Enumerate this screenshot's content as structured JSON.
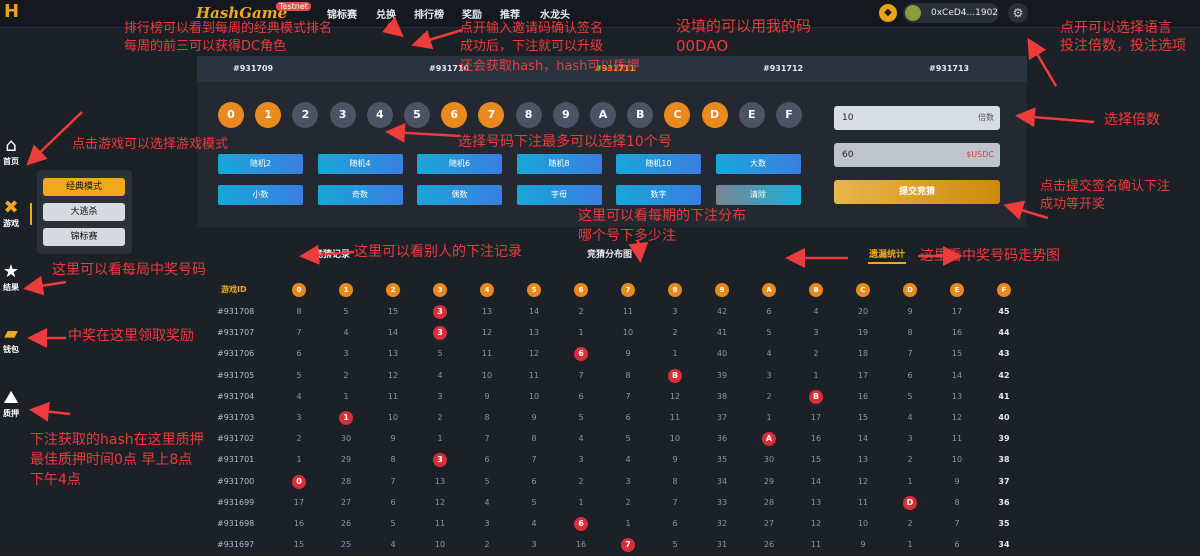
{
  "topbar": {
    "logo": "H",
    "brand": "HashGame",
    "brand_tag": "Testnet",
    "nav": [
      "锦标赛",
      "兑换",
      "排行榜",
      "奖励",
      "推荐",
      "水龙头"
    ],
    "wallet_icon": "wallet-icon",
    "address": "0xCeD4...1902",
    "gear_icon": "gear-icon"
  },
  "sidebar": {
    "items": [
      {
        "label": "首页",
        "icon": "home-icon",
        "glyph": "⌂"
      },
      {
        "label": "游戏",
        "icon": "game-icon",
        "glyph": "✖"
      },
      {
        "label": "结果",
        "icon": "star-icon",
        "glyph": "★"
      },
      {
        "label": "钱包",
        "icon": "wallet-icon",
        "glyph": "▰"
      },
      {
        "label": "质押",
        "icon": "stake-icon",
        "glyph": "⛰"
      }
    ],
    "submenu": [
      "经典模式",
      "大逃杀",
      "锦标赛"
    ]
  },
  "game": {
    "rounds": [
      "#931709",
      "#931710",
      "#931711",
      "#931712",
      "#931713"
    ],
    "balls": [
      {
        "label": "0",
        "state": "hot"
      },
      {
        "label": "1",
        "state": "hot"
      },
      {
        "label": "2",
        "state": "cold"
      },
      {
        "label": "3",
        "state": "cold"
      },
      {
        "label": "4",
        "state": "cold"
      },
      {
        "label": "5",
        "state": "cold"
      },
      {
        "label": "6",
        "state": "hot"
      },
      {
        "label": "7",
        "state": "hot"
      },
      {
        "label": "8",
        "state": "cold"
      },
      {
        "label": "9",
        "state": "cold"
      },
      {
        "label": "A",
        "state": "cold"
      },
      {
        "label": "B",
        "state": "cold"
      },
      {
        "label": "C",
        "state": "hot"
      },
      {
        "label": "D",
        "state": "hot"
      },
      {
        "label": "E",
        "state": "cold"
      },
      {
        "label": "F",
        "state": "cold"
      }
    ],
    "random_buttons_row1": [
      "随机2",
      "随机4",
      "随机6",
      "随机8",
      "随机10",
      "大数"
    ],
    "random_buttons_row2": [
      "小数",
      "奇数",
      "偶数",
      "字母",
      "数字",
      "清除"
    ],
    "multiplier_value": "10",
    "multiplier_suffix": "倍数",
    "amount_value": "60",
    "amount_suffix": "$USDC",
    "submit_label": "提交竞猜"
  },
  "stats": {
    "tabs": [
      "竞猜记录",
      "竞猜分布图",
      "遗漏统计"
    ],
    "active_tab": "遗漏统计",
    "id_header": "游戏ID",
    "columns": [
      "0",
      "1",
      "2",
      "3",
      "4",
      "5",
      "6",
      "7",
      "8",
      "9",
      "A",
      "B",
      "C",
      "D",
      "E",
      "F"
    ],
    "rows": [
      {
        "id": "#931708",
        "cells": [
          "8",
          "5",
          "15",
          "3",
          "13",
          "14",
          "2",
          "11",
          "3",
          "42",
          "6",
          "4",
          "20",
          "9",
          "17",
          "45"
        ],
        "hit": 3
      },
      {
        "id": "#931707",
        "cells": [
          "7",
          "4",
          "14",
          "3",
          "12",
          "13",
          "1",
          "10",
          "2",
          "41",
          "5",
          "3",
          "19",
          "8",
          "16",
          "44"
        ],
        "hit": 3
      },
      {
        "id": "#931706",
        "cells": [
          "6",
          "3",
          "13",
          "5",
          "11",
          "12",
          "6",
          "9",
          "1",
          "40",
          "4",
          "2",
          "18",
          "7",
          "15",
          "43"
        ],
        "hit": 6
      },
      {
        "id": "#931705",
        "cells": [
          "5",
          "2",
          "12",
          "4",
          "10",
          "11",
          "7",
          "8",
          "B",
          "39",
          "3",
          "1",
          "17",
          "6",
          "14",
          "42"
        ],
        "hit": 8
      },
      {
        "id": "#931704",
        "cells": [
          "4",
          "1",
          "11",
          "3",
          "9",
          "10",
          "6",
          "7",
          "12",
          "38",
          "2",
          "B",
          "16",
          "5",
          "13",
          "41"
        ],
        "hit": 11
      },
      {
        "id": "#931703",
        "cells": [
          "3",
          "1",
          "10",
          "2",
          "8",
          "9",
          "5",
          "6",
          "11",
          "37",
          "1",
          "17",
          "15",
          "4",
          "12",
          "40"
        ],
        "hit": 1
      },
      {
        "id": "#931702",
        "cells": [
          "2",
          "30",
          "9",
          "1",
          "7",
          "8",
          "4",
          "5",
          "10",
          "36",
          "A",
          "16",
          "14",
          "3",
          "11",
          "39"
        ],
        "hit": 10
      },
      {
        "id": "#931701",
        "cells": [
          "1",
          "29",
          "8",
          "3",
          "6",
          "7",
          "3",
          "4",
          "9",
          "35",
          "30",
          "15",
          "13",
          "2",
          "10",
          "38"
        ],
        "hit": 3
      },
      {
        "id": "#931700",
        "cells": [
          "0",
          "28",
          "7",
          "13",
          "5",
          "6",
          "2",
          "3",
          "8",
          "34",
          "29",
          "14",
          "12",
          "1",
          "9",
          "37"
        ],
        "hit": 0
      },
      {
        "id": "#931699",
        "cells": [
          "17",
          "27",
          "6",
          "12",
          "4",
          "5",
          "1",
          "2",
          "7",
          "33",
          "28",
          "13",
          "11",
          "D",
          "8",
          "36"
        ],
        "hit": 13
      },
      {
        "id": "#931698",
        "cells": [
          "16",
          "26",
          "5",
          "11",
          "3",
          "4",
          "6",
          "1",
          "6",
          "32",
          "27",
          "12",
          "10",
          "2",
          "7",
          "35"
        ],
        "hit": 6
      },
      {
        "id": "#931697",
        "cells": [
          "15",
          "25",
          "4",
          "10",
          "2",
          "3",
          "16",
          "7",
          "5",
          "31",
          "26",
          "11",
          "9",
          "1",
          "6",
          "34"
        ],
        "hit": 7
      },
      {
        "id": "#931696",
        "cells": [
          "14",
          "24",
          "3",
          "9",
          "1",
          "2",
          "15",
          "12",
          "4",
          "30",
          "25",
          "10",
          "8",
          "D",
          "5",
          "33"
        ],
        "hit": 13
      }
    ]
  },
  "annotations": [
    "排行榜可以看到每周的经典模式排名",
    "每周的前三可以获得DC角色",
    "点开输入邀请码确认签名",
    "成功后，下注就可以升级",
    "还会获取hash，hash可以质押",
    "没填的可以用我的码",
    "00DAO",
    "点开可以选择语言",
    "投注倍数，投注选项",
    "选择倍数",
    "点击游戏可以选择游戏模式",
    "选择号码下注最多可以选择10个号",
    "点击提交签名确认下注",
    "成功等开奖",
    "这里可以看每期的下注分布",
    "哪个号下多少注",
    "这里可以看别人的下注记录",
    "这里看中奖号码走势图",
    "这里可以看每局中奖号码",
    "中奖在这里领取奖励",
    "下注获取的hash在这里质押",
    "最佳质押时间0点 早上8点",
    "下午4点"
  ],
  "colors": {
    "accent": "#f0a91b",
    "annotation": "#ee3b3b",
    "hit": "#d62f3a"
  }
}
